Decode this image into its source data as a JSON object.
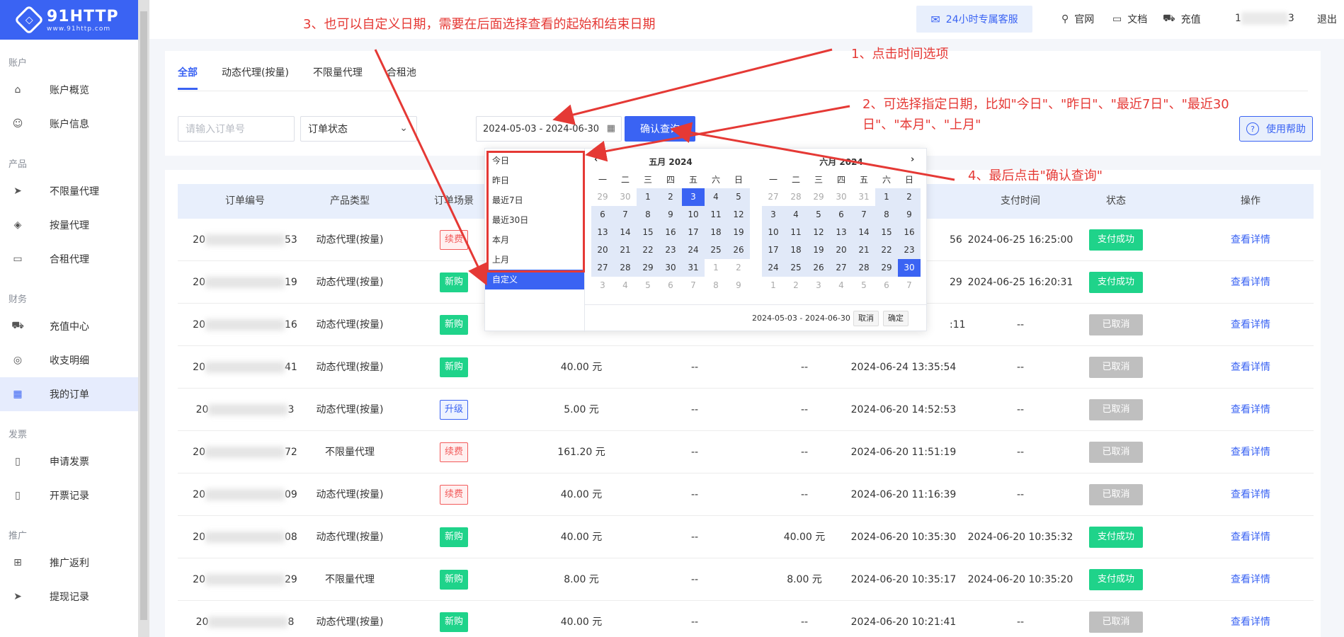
{
  "logo": {
    "title": "91HTTP",
    "sub": "www.91http.com"
  },
  "sidebar": {
    "sections": [
      {
        "label": "账户",
        "items": [
          {
            "label": "账户概览",
            "icon": "home-icon",
            "glyph": "⌂"
          },
          {
            "label": "账户信息",
            "icon": "user-icon",
            "glyph": "☺"
          }
        ]
      },
      {
        "label": "产品",
        "items": [
          {
            "label": "不限量代理",
            "icon": "send-icon",
            "glyph": "➤"
          },
          {
            "label": "按量代理",
            "icon": "cube-icon",
            "glyph": "◈"
          },
          {
            "label": "合租代理",
            "icon": "chat-icon",
            "glyph": "▭"
          }
        ]
      },
      {
        "label": "财务",
        "items": [
          {
            "label": "充值中心",
            "icon": "cart-icon",
            "glyph": "⛟"
          },
          {
            "label": "收支明细",
            "icon": "coin-icon",
            "glyph": "◎"
          },
          {
            "label": "我的订单",
            "icon": "calendar-icon",
            "glyph": "▦",
            "active": true
          }
        ]
      },
      {
        "label": "发票",
        "items": [
          {
            "label": "申请发票",
            "icon": "invoice-icon",
            "glyph": "▯"
          },
          {
            "label": "开票记录",
            "icon": "record-icon",
            "glyph": "▯"
          }
        ]
      },
      {
        "label": "推广",
        "items": [
          {
            "label": "推广返利",
            "icon": "gift-icon",
            "glyph": "⊞"
          },
          {
            "label": "提现记录",
            "icon": "send-icon",
            "glyph": "➤"
          }
        ]
      }
    ]
  },
  "header": {
    "service": "24小时专属客服",
    "links": [
      {
        "label": "官网",
        "icon": "location-icon",
        "glyph": "⚲"
      },
      {
        "label": "文档",
        "icon": "folder-icon",
        "glyph": "▭"
      },
      {
        "label": "充值",
        "icon": "cart-icon",
        "glyph": "⛟"
      }
    ],
    "phone_start": "1",
    "phone_end": "3",
    "logout": "退出"
  },
  "tabs": [
    "全部",
    "动态代理(按量)",
    "不限量代理",
    "合租池"
  ],
  "filters": {
    "order_placeholder": "请输入订单号",
    "status_placeholder": "订单状态",
    "date_range": "2024-05-03 - 2024-06-30",
    "query_button": "确认查询",
    "help_button": "使用帮助"
  },
  "table": {
    "headers": [
      "订单编号",
      "产品类型",
      "订单场景",
      "支付时间",
      "状态",
      "操作"
    ],
    "rows": [
      {
        "id_start": "20",
        "id_end": "53",
        "type": "动态代理(按量)",
        "scene": "续费",
        "scene_kind": "renew",
        "amount": "",
        "c1": "",
        "c2": "",
        "created": "56",
        "paid": "2024-06-25 16:25:00",
        "status": "支付成功",
        "status_kind": "ok",
        "action": "查看详情"
      },
      {
        "id_start": "20",
        "id_end": "19",
        "type": "动态代理(按量)",
        "scene": "新购",
        "scene_kind": "new",
        "amount": "",
        "c1": "",
        "c2": "",
        "created": "29",
        "paid": "2024-06-25 16:20:31",
        "status": "支付成功",
        "status_kind": "ok",
        "action": "查看详情"
      },
      {
        "id_start": "20",
        "id_end": "16",
        "type": "动态代理(按量)",
        "scene": "新购",
        "scene_kind": "new",
        "amount": "",
        "c1": "",
        "c2": "",
        "created": ":11",
        "paid": "--",
        "status": "已取消",
        "status_kind": "cancel",
        "action": "查看详情"
      },
      {
        "id_start": "20",
        "id_end": "41",
        "type": "动态代理(按量)",
        "scene": "新购",
        "scene_kind": "new",
        "amount": "40.00 元",
        "c1": "--",
        "c2": "--",
        "created": "2024-06-24 13:35:54",
        "paid": "--",
        "status": "已取消",
        "status_kind": "cancel",
        "action": "查看详情"
      },
      {
        "id_start": "20",
        "id_end": "3",
        "type": "动态代理(按量)",
        "scene": "升级",
        "scene_kind": "up",
        "amount": "5.00 元",
        "c1": "--",
        "c2": "--",
        "created": "2024-06-20 14:52:53",
        "paid": "--",
        "status": "已取消",
        "status_kind": "cancel",
        "action": "查看详情"
      },
      {
        "id_start": "20",
        "id_end": "72",
        "type": "不限量代理",
        "scene": "续费",
        "scene_kind": "renew",
        "amount": "161.20 元",
        "c1": "--",
        "c2": "--",
        "created": "2024-06-20 11:51:19",
        "paid": "--",
        "status": "已取消",
        "status_kind": "cancel",
        "action": "查看详情"
      },
      {
        "id_start": "20",
        "id_end": "09",
        "type": "动态代理(按量)",
        "scene": "续费",
        "scene_kind": "renew",
        "amount": "40.00 元",
        "c1": "--",
        "c2": "--",
        "created": "2024-06-20 11:16:39",
        "paid": "--",
        "status": "已取消",
        "status_kind": "cancel",
        "action": "查看详情"
      },
      {
        "id_start": "20",
        "id_end": "08",
        "type": "动态代理(按量)",
        "scene": "新购",
        "scene_kind": "new",
        "amount": "40.00 元",
        "c1": "--",
        "c2": "40.00 元",
        "created": "2024-06-20 10:35:30",
        "paid": "2024-06-20 10:35:32",
        "status": "支付成功",
        "status_kind": "ok",
        "action": "查看详情"
      },
      {
        "id_start": "20",
        "id_end": "29",
        "type": "不限量代理",
        "scene": "新购",
        "scene_kind": "new",
        "amount": "8.00 元",
        "c1": "--",
        "c2": "8.00 元",
        "created": "2024-06-20 10:35:17",
        "paid": "2024-06-20 10:35:20",
        "status": "支付成功",
        "status_kind": "ok",
        "action": "查看详情"
      },
      {
        "id_start": "20",
        "id_end": "8",
        "type": "动态代理(按量)",
        "scene": "新购",
        "scene_kind": "new",
        "amount": "40.00 元",
        "c1": "--",
        "c2": "--",
        "created": "2024-06-20 10:21:41",
        "paid": "--",
        "status": "已取消",
        "status_kind": "cancel",
        "action": "查看详情"
      }
    ]
  },
  "picker": {
    "shortcuts": [
      "今日",
      "昨日",
      "最近7日",
      "最近30日",
      "本月",
      "上月",
      "自定义"
    ],
    "active_shortcut": "自定义",
    "weekdays": [
      "一",
      "二",
      "三",
      "四",
      "五",
      "六",
      "日"
    ],
    "left": {
      "title": "五月 2024",
      "days": [
        [
          "29",
          "out"
        ],
        [
          "30",
          "out"
        ],
        [
          "1",
          "range"
        ],
        [
          "2",
          "range"
        ],
        [
          "3",
          "sel"
        ],
        [
          "4",
          "range"
        ],
        [
          "5",
          "range"
        ],
        [
          "6",
          "range"
        ],
        [
          "7",
          "range"
        ],
        [
          "8",
          "range"
        ],
        [
          "9",
          "range"
        ],
        [
          "10",
          "range"
        ],
        [
          "11",
          "range"
        ],
        [
          "12",
          "range"
        ],
        [
          "13",
          "range"
        ],
        [
          "14",
          "range"
        ],
        [
          "15",
          "range"
        ],
        [
          "16",
          "range"
        ],
        [
          "17",
          "range"
        ],
        [
          "18",
          "range"
        ],
        [
          "19",
          "range"
        ],
        [
          "20",
          "range"
        ],
        [
          "21",
          "range"
        ],
        [
          "22",
          "range"
        ],
        [
          "23",
          "range"
        ],
        [
          "24",
          "range"
        ],
        [
          "25",
          "range"
        ],
        [
          "26",
          "range"
        ],
        [
          "27",
          "range"
        ],
        [
          "28",
          "range"
        ],
        [
          "29",
          "range"
        ],
        [
          "30",
          "range"
        ],
        [
          "31",
          "range"
        ],
        [
          "1",
          "out"
        ],
        [
          "2",
          "out"
        ],
        [
          "3",
          "out"
        ],
        [
          "4",
          "out"
        ],
        [
          "5",
          "out"
        ],
        [
          "6",
          "out"
        ],
        [
          "7",
          "out"
        ],
        [
          "8",
          "out"
        ],
        [
          "9",
          "out"
        ]
      ]
    },
    "right": {
      "title": "六月 2024",
      "days": [
        [
          "27",
          "out"
        ],
        [
          "28",
          "out"
        ],
        [
          "29",
          "out"
        ],
        [
          "30",
          "out"
        ],
        [
          "31",
          "out"
        ],
        [
          "1",
          "range"
        ],
        [
          "2",
          "range"
        ],
        [
          "3",
          "range"
        ],
        [
          "4",
          "range"
        ],
        [
          "5",
          "range"
        ],
        [
          "6",
          "range"
        ],
        [
          "7",
          "range"
        ],
        [
          "8",
          "range"
        ],
        [
          "9",
          "range"
        ],
        [
          "10",
          "range"
        ],
        [
          "11",
          "range"
        ],
        [
          "12",
          "range"
        ],
        [
          "13",
          "range"
        ],
        [
          "14",
          "range"
        ],
        [
          "15",
          "range"
        ],
        [
          "16",
          "range"
        ],
        [
          "17",
          "range"
        ],
        [
          "18",
          "range"
        ],
        [
          "19",
          "range"
        ],
        [
          "20",
          "range"
        ],
        [
          "21",
          "range"
        ],
        [
          "22",
          "range"
        ],
        [
          "23",
          "range"
        ],
        [
          "24",
          "range"
        ],
        [
          "25",
          "range"
        ],
        [
          "26",
          "range"
        ],
        [
          "27",
          "range"
        ],
        [
          "28",
          "range"
        ],
        [
          "29",
          "range"
        ],
        [
          "30",
          "sel"
        ],
        [
          "1",
          "out"
        ],
        [
          "2",
          "out"
        ],
        [
          "3",
          "out"
        ],
        [
          "4",
          "out"
        ],
        [
          "5",
          "out"
        ],
        [
          "6",
          "out"
        ],
        [
          "7",
          "out"
        ]
      ]
    },
    "footer_range": "2024-05-03 - 2024-06-30",
    "cancel": "取消",
    "confirm": "确定"
  },
  "annotations": {
    "a1": "1、点击时间选项",
    "a2_line1": "2、可选择指定日期，比如\"今日\"、\"昨日\"、\"最近7日\"、\"最近30",
    "a2_line2": "日\"、\"本月\"、\"上月\"",
    "a3": "3、也可以自定义日期，需要在后面选择查看的起始和结束日期",
    "a4": "4、最后点击\"确认查询\""
  },
  "colors": {
    "primary": "#3a63f3",
    "success": "#1fd38a",
    "annotation": "#e53935",
    "cancelled": "#bfbfbf"
  }
}
